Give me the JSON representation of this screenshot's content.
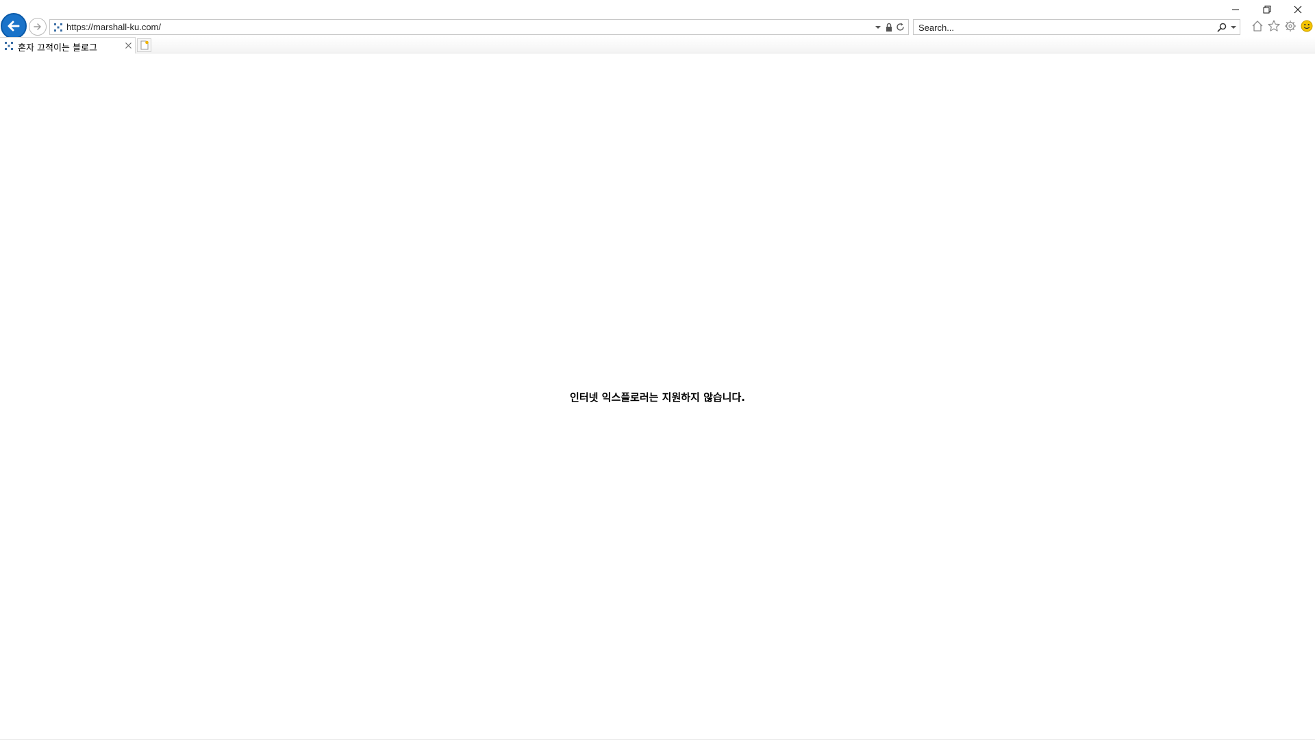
{
  "browser": {
    "address": {
      "url": "https://marshall-ku.com/"
    },
    "search": {
      "placeholder": "Search..."
    },
    "tabs": [
      {
        "title": "혼자 끄적이는 블로그",
        "active": true
      }
    ],
    "toolbar_icons": [
      "home-icon",
      "favorites-star-icon",
      "settings-gear-icon",
      "feedback-smiley-icon"
    ],
    "window_controls": [
      "minimize",
      "restore",
      "close"
    ],
    "accent_color": "#1a73c9"
  },
  "page": {
    "message": "인터넷 익스플로러는 지원하지 않습니다."
  }
}
